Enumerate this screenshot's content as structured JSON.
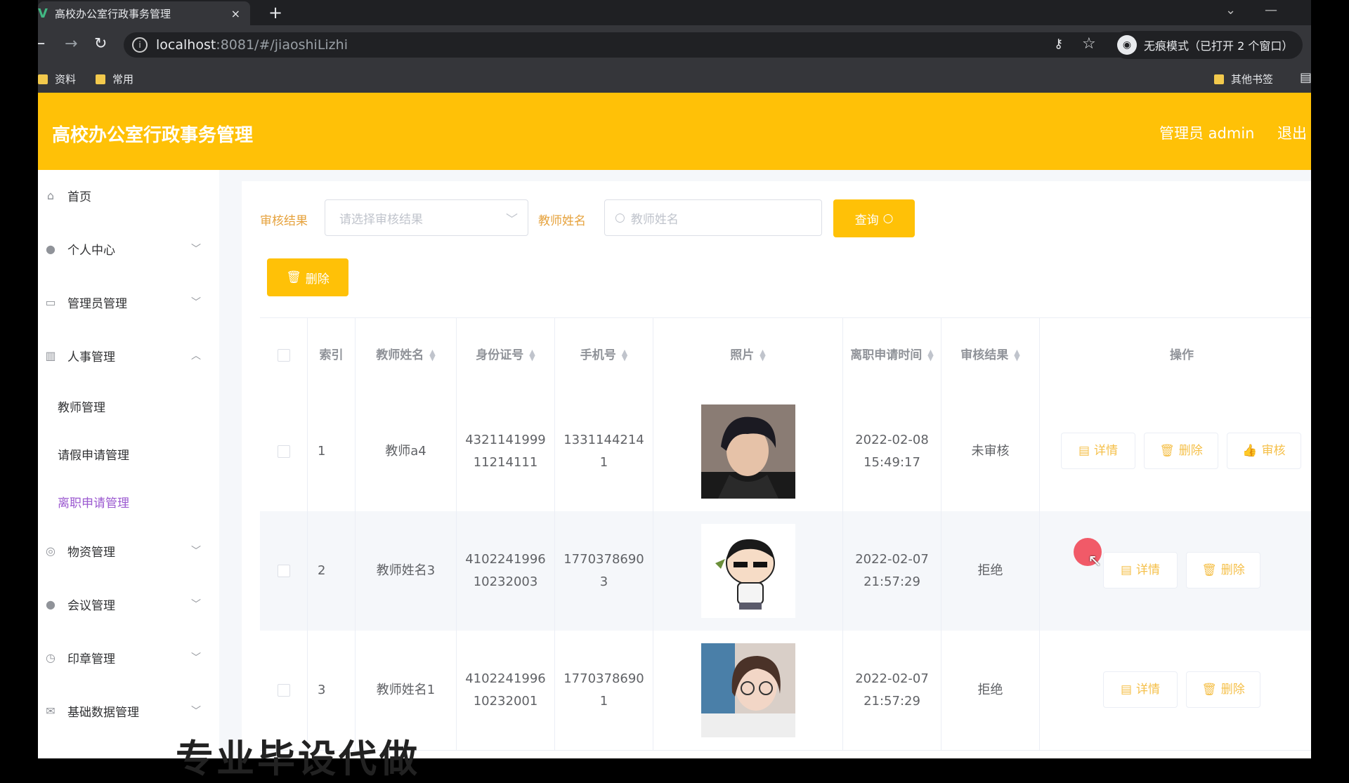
{
  "browser": {
    "tab_title": "高校办公室行政事务管理",
    "tab_close": "×",
    "new_tab": "+",
    "url_host": "localhost",
    "url_path": ":8081/#/jiaoshiLizhi",
    "incognito_label": "无痕模式（已打开 2 个窗口）",
    "bookmarks": [
      "资料",
      "常用"
    ],
    "other_bookmarks": "其他书签"
  },
  "header": {
    "title": "高校办公室行政事务管理",
    "user_label": "管理员 admin",
    "logout": "退出"
  },
  "sidebar": {
    "items": [
      {
        "label": "首页",
        "icon": "home-icon"
      },
      {
        "label": "个人中心",
        "icon": "user-icon"
      },
      {
        "label": "管理员管理",
        "icon": "admin-icon"
      },
      {
        "label": "人事管理",
        "icon": "chart-icon"
      },
      {
        "label": "物资管理",
        "icon": "compass-icon"
      },
      {
        "label": "会议管理",
        "icon": "meeting-icon"
      },
      {
        "label": "印章管理",
        "icon": "seal-icon"
      },
      {
        "label": "基础数据管理",
        "icon": "mail-icon"
      }
    ],
    "sub_items": [
      "教师管理",
      "请假申请管理",
      "离职申请管理"
    ],
    "active_sub": "离职申请管理"
  },
  "filters": {
    "result_label": "审核结果",
    "result_placeholder": "请选择审核结果",
    "name_label": "教师姓名",
    "name_placeholder": "教师姓名",
    "query_button": "查询",
    "delete_button": "删除"
  },
  "table": {
    "columns": [
      "索引",
      "教师姓名",
      "身份证号",
      "手机号",
      "照片",
      "离职申请时间",
      "审核结果",
      "操作"
    ],
    "rows": [
      {
        "index": "1",
        "name": "教师a4",
        "id_line1": "4321141999",
        "id_line2": "11214111",
        "phone_line1": "1331144214",
        "phone_line2": "1",
        "date": "2022-02-08",
        "time": "15:49:17",
        "result": "未审核"
      },
      {
        "index": "2",
        "name": "教师姓名3",
        "id_line1": "4102241996",
        "id_line2": "10232003",
        "phone_line1": "1770378690",
        "phone_line2": "3",
        "date": "2022-02-07",
        "time": "21:57:29",
        "result": "拒绝"
      },
      {
        "index": "3",
        "name": "教师姓名1",
        "id_line1": "4102241996",
        "id_line2": "10232001",
        "phone_line1": "1770378690",
        "phone_line2": "1",
        "date": "2022-02-07",
        "time": "21:57:29",
        "result": "拒绝"
      }
    ],
    "actions": {
      "detail": "详情",
      "delete": "删除",
      "review": "审核"
    }
  },
  "watermark": "专业毕设代做"
}
